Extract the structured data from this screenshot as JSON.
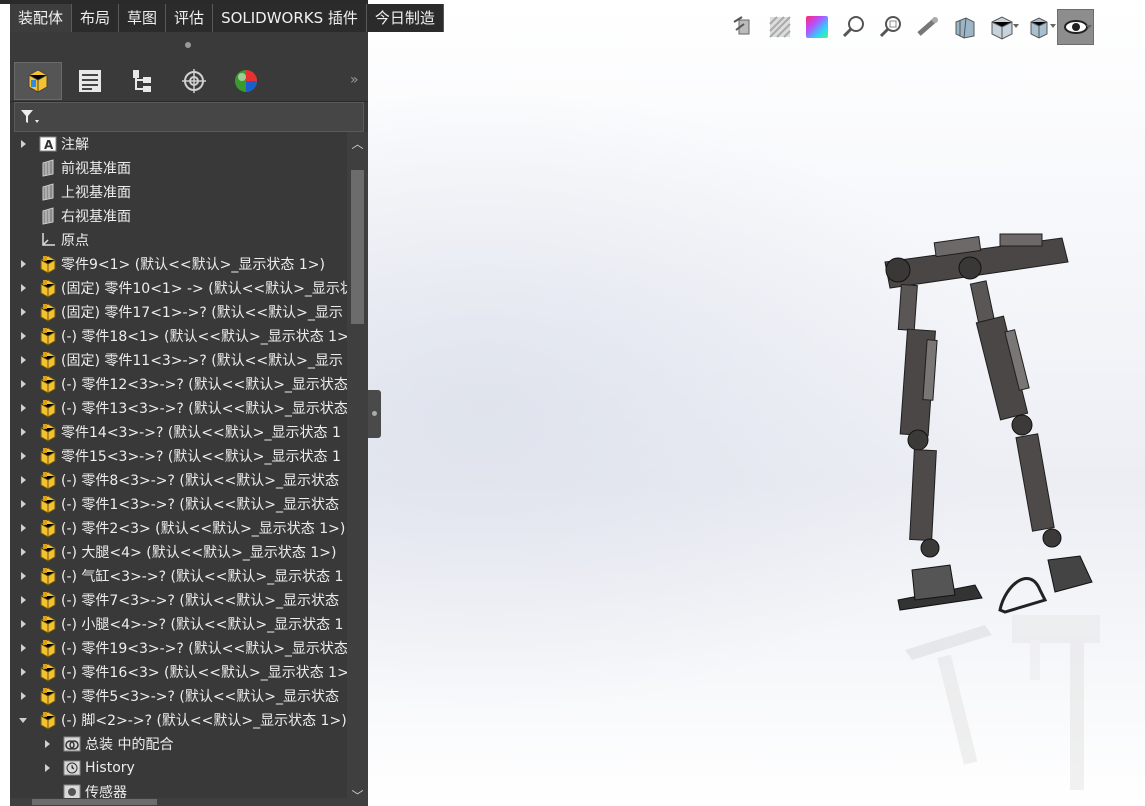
{
  "command_tabs": [
    {
      "label": "装配体",
      "active": true
    },
    {
      "label": "布局",
      "active": false
    },
    {
      "label": "草图",
      "active": false
    },
    {
      "label": "评估",
      "active": false
    },
    {
      "label": "SOLIDWORKS 插件",
      "active": false
    },
    {
      "label": "今日制造",
      "active": false
    }
  ],
  "hud_tools": [
    {
      "name": "previous-view-icon"
    },
    {
      "name": "section-view-icon"
    },
    {
      "name": "appearance-icon"
    },
    {
      "name": "zoom-to-fit-icon"
    },
    {
      "name": "zoom-to-area-icon"
    },
    {
      "name": "rotate-view-icon"
    },
    {
      "name": "view-orientation-icon"
    },
    {
      "name": "display-style-icon"
    },
    {
      "name": "hide-show-items-icon"
    },
    {
      "name": "edit-appearance-icon"
    }
  ],
  "manager_tabs": [
    {
      "name": "featuremanager-tab",
      "active": true
    },
    {
      "name": "propertymanager-tab",
      "active": false
    },
    {
      "name": "configurationmanager-tab",
      "active": false
    },
    {
      "name": "dimxpertmanager-tab",
      "active": false
    },
    {
      "name": "displaymanager-tab",
      "active": false
    }
  ],
  "tree": {
    "items": [
      {
        "label": "注解",
        "type": "annotation",
        "arrow": "right",
        "indent": 0
      },
      {
        "label": "前视基准面",
        "type": "plane",
        "arrow": "none",
        "indent": 0
      },
      {
        "label": "上视基准面",
        "type": "plane",
        "arrow": "none",
        "indent": 0
      },
      {
        "label": "右视基准面",
        "type": "plane",
        "arrow": "none",
        "indent": 0
      },
      {
        "label": "原点",
        "type": "origin",
        "arrow": "none",
        "indent": 0
      },
      {
        "label": "零件9<1> (默认<<默认>_显示状态 1>)",
        "type": "part",
        "arrow": "right",
        "indent": 0
      },
      {
        "label": "(固定) 零件10<1> -> (默认<<默认>_显示状",
        "type": "part",
        "arrow": "right",
        "indent": 0
      },
      {
        "label": "(固定) 零件17<1>->? (默认<<默认>_显示",
        "type": "part",
        "arrow": "right",
        "indent": 0
      },
      {
        "label": "(-) 零件18<1> (默认<<默认>_显示状态 1>",
        "type": "part",
        "arrow": "right",
        "indent": 0
      },
      {
        "label": "(固定) 零件11<3>->? (默认<<默认>_显示",
        "type": "part",
        "arrow": "right",
        "indent": 0
      },
      {
        "label": "(-) 零件12<3>->? (默认<<默认>_显示状态",
        "type": "part",
        "arrow": "right",
        "indent": 0
      },
      {
        "label": "(-) 零件13<3>->? (默认<<默认>_显示状态",
        "type": "part",
        "arrow": "right",
        "indent": 0
      },
      {
        "label": "零件14<3>->? (默认<<默认>_显示状态 1",
        "type": "part",
        "arrow": "right",
        "indent": 0
      },
      {
        "label": "零件15<3>->? (默认<<默认>_显示状态 1",
        "type": "part",
        "arrow": "right",
        "indent": 0
      },
      {
        "label": "(-) 零件8<3>->? (默认<<默认>_显示状态",
        "type": "part",
        "arrow": "right",
        "indent": 0
      },
      {
        "label": "(-) 零件1<3>->? (默认<<默认>_显示状态",
        "type": "part",
        "arrow": "right",
        "indent": 0
      },
      {
        "label": "(-) 零件2<3> (默认<<默认>_显示状态 1>)",
        "type": "part",
        "arrow": "right",
        "indent": 0
      },
      {
        "label": "(-) 大腿<4> (默认<<默认>_显示状态 1>)",
        "type": "part",
        "arrow": "right",
        "indent": 0
      },
      {
        "label": "(-) 气缸<3>->? (默认<<默认>_显示状态 1",
        "type": "part",
        "arrow": "right",
        "indent": 0
      },
      {
        "label": "(-) 零件7<3>->? (默认<<默认>_显示状态",
        "type": "part",
        "arrow": "right",
        "indent": 0
      },
      {
        "label": "(-) 小腿<4>->? (默认<<默认>_显示状态 1",
        "type": "part",
        "arrow": "right",
        "indent": 0
      },
      {
        "label": "(-) 零件19<3>->? (默认<<默认>_显示状态",
        "type": "part",
        "arrow": "right",
        "indent": 0
      },
      {
        "label": "(-) 零件16<3> (默认<<默认>_显示状态 1>",
        "type": "part",
        "arrow": "right",
        "indent": 0
      },
      {
        "label": "(-) 零件5<3>->? (默认<<默认>_显示状态",
        "type": "part",
        "arrow": "right",
        "indent": 0
      },
      {
        "label": "(-) 脚<2>->? (默认<<默认>_显示状态 1>)",
        "type": "part",
        "arrow": "down",
        "indent": 0
      },
      {
        "label": "总装 中的配合",
        "type": "mates",
        "arrow": "right",
        "indent": 1
      },
      {
        "label": "History",
        "type": "history",
        "arrow": "right",
        "indent": 1
      },
      {
        "label": "传感器",
        "type": "sensor",
        "arrow": "none",
        "indent": 1
      }
    ]
  },
  "colors": {
    "panel_bg": "#393939",
    "part_icon": "#f2c230",
    "tab_bar": "#2b2b2b"
  }
}
